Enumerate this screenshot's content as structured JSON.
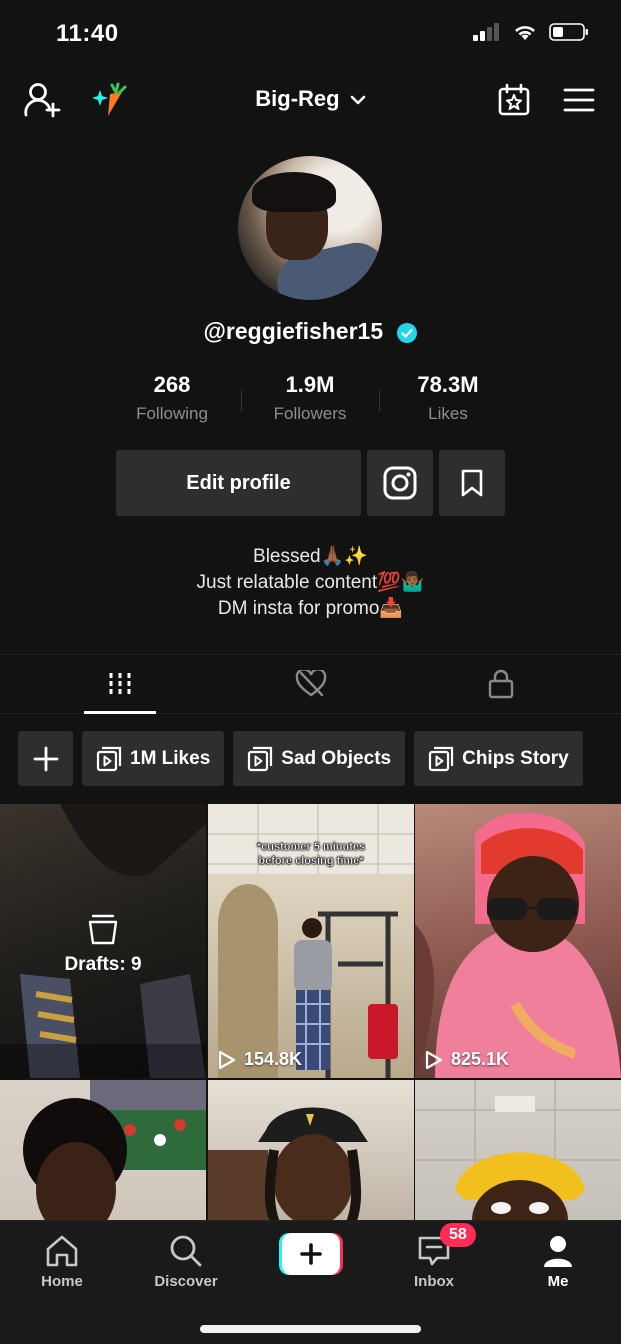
{
  "status": {
    "time": "11:40"
  },
  "header": {
    "profile_name": "Big-Reg"
  },
  "profile": {
    "handle": "@reggiefisher15",
    "stats": [
      {
        "value": "268",
        "label": "Following"
      },
      {
        "value": "1.9M",
        "label": "Followers"
      },
      {
        "value": "78.3M",
        "label": "Likes"
      }
    ],
    "edit_label": "Edit profile",
    "bio": [
      "Blessed🙏🏾✨",
      "Just relatable content💯🤷🏾‍♂️",
      "DM insta for promo📥"
    ]
  },
  "playlists": [
    {
      "label": "1M Likes"
    },
    {
      "label": "Sad Objects"
    },
    {
      "label": "Chips Story"
    }
  ],
  "grid": {
    "drafts_label": "Drafts: 9",
    "videos": [
      {
        "views": "154.8K",
        "caption": "*customer 5 minutes before closing time*"
      },
      {
        "views": "825.1K"
      }
    ]
  },
  "nav": {
    "home": "Home",
    "discover": "Discover",
    "inbox": "Inbox",
    "inbox_badge": "58",
    "me": "Me"
  },
  "colors": {
    "accent_red": "#fe2c55",
    "accent_cyan": "#25f4ee",
    "verified_blue": "#20d5ec"
  }
}
